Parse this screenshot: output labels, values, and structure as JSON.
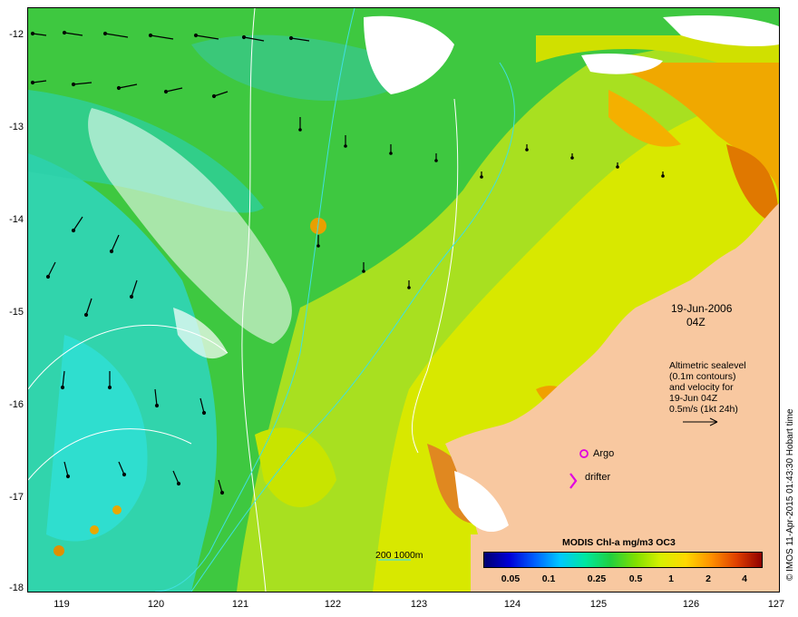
{
  "axes": {
    "x_ticks": [
      "119",
      "120",
      "121",
      "122",
      "123",
      "124",
      "125",
      "126",
      "127"
    ],
    "y_ticks": [
      "-12",
      "-13",
      "-14",
      "-15",
      "-16",
      "-17",
      "-18"
    ]
  },
  "annotations": {
    "date": "19-Jun-2006",
    "time": "04Z",
    "altimetry_lines": [
      "Altimetric sealevel",
      "(0.1m contours)",
      "and velocity for",
      "19-Jun 04Z",
      "0.5m/s (1kt 24h)"
    ],
    "argo": "Argo",
    "drifter": "drifter",
    "depth_contours": "200  1000m"
  },
  "colorbar": {
    "title": "MODIS Chl-a mg/m3 OC3",
    "ticks": [
      "0.05",
      "0.1",
      "0.25",
      "0.5",
      "1",
      "2",
      "4"
    ]
  },
  "credit": "© IMOS 11-Apr-2015 01:43:30 Hobart time",
  "colors": {
    "land": "#f8c8a0",
    "ocean_green": "#3cc83c",
    "ocean_cyan": "#30d8c8",
    "chl_yellow": "#d0e800",
    "chl_orange": "#f0a000",
    "argo_marker": "#e000e0",
    "contour_cyan": "#40e0e0"
  }
}
